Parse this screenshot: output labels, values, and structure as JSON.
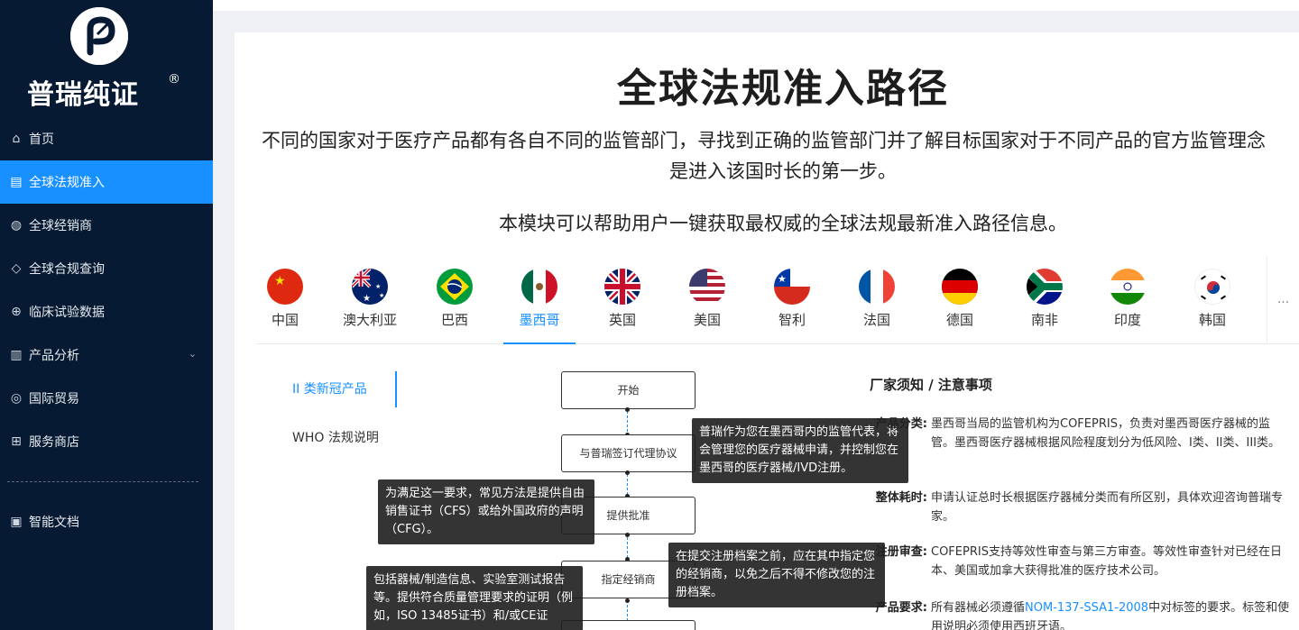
{
  "brand": {
    "name": "普瑞纯证",
    "reg": "®"
  },
  "nav": [
    {
      "label": "首页",
      "icon": "⌂"
    },
    {
      "label": "全球法规准入",
      "icon": "▤",
      "active": true
    },
    {
      "label": "全球经销商",
      "icon": "◍"
    },
    {
      "label": "全球合规查询",
      "icon": "◇"
    },
    {
      "label": "临床试验数据",
      "icon": "⊕"
    },
    {
      "label": "产品分析",
      "icon": "▥",
      "arrow": "⌄"
    },
    {
      "label": "国际贸易",
      "icon": "◎"
    },
    {
      "label": "服务商店",
      "icon": "⊞"
    },
    {
      "label": "智能文档",
      "icon": "▣"
    }
  ],
  "page": {
    "title": "全球法规准入路径",
    "desc_line1": "不同的国家对于医疗产品都有各自不同的监管部门，寻找到正确的监管部门并了解目标国家对于不同产品的官方监管理念",
    "desc_line2": "是进入该国时长的第一步。",
    "desc_line3": "本模块可以帮助用户一键获取最权威的全球法规最新准入路径信息。"
  },
  "countries": [
    "中国",
    "澳大利亚",
    "巴西",
    "墨西哥",
    "英国",
    "美国",
    "智利",
    "法国",
    "德国",
    "南非",
    "印度",
    "韩国"
  ],
  "active_country": "墨西哥",
  "more": "...",
  "submenu": [
    "II 类新冠产品",
    "WHO 法规说明"
  ],
  "flow": {
    "boxes": [
      "开始",
      "与普瑞签订代理协议",
      "提供批准",
      "指定经销商"
    ],
    "tips": [
      "普瑞作为您在墨西哥内的监管代表，将会管理您的医疗器械申请，并控制您在墨西哥的医疗器械/IVD注册。",
      "为满足这一要求，常见方法是提供自由销售证书（CFS）或给外国政府的声明（CFG）。",
      "在提交注册档案之前，应在其中指定您的经销商，以免之后不得不修改您的注册档案。",
      "包括器械/制造信息、实验室测试报告等。提供符合质量管理要求的证明（例如，ISO 13485证书）和/或CE证"
    ]
  },
  "notes": {
    "title": "厂家须知 / 注意事项",
    "items": [
      {
        "label": "产品分类:",
        "text": "墨西哥当局的监管机构为COFEPRIS，负责对墨西哥医疗器械的监管。墨西哥医疗器械根据风险程度划分为低风险、I类、II类、III类。"
      },
      {
        "label": "整体耗时:",
        "text": "申请认证总时长根据医疗器械分类而有所区别，具体欢迎咨询普瑞专家。"
      },
      {
        "label": "注册审查:",
        "text": "COFEPRIS支持等效性审查与第三方审查。等效性审查针对已经在日本、美国或加拿大获得批准的医疗技术公司。"
      },
      {
        "label": "产品要求:",
        "text_pre": "所有器械必须遵循",
        "link": "NOM-137-SSA1-2008",
        "text_post": "中对标签的要求。标签和使用说明必须使用西班牙语。"
      }
    ]
  }
}
